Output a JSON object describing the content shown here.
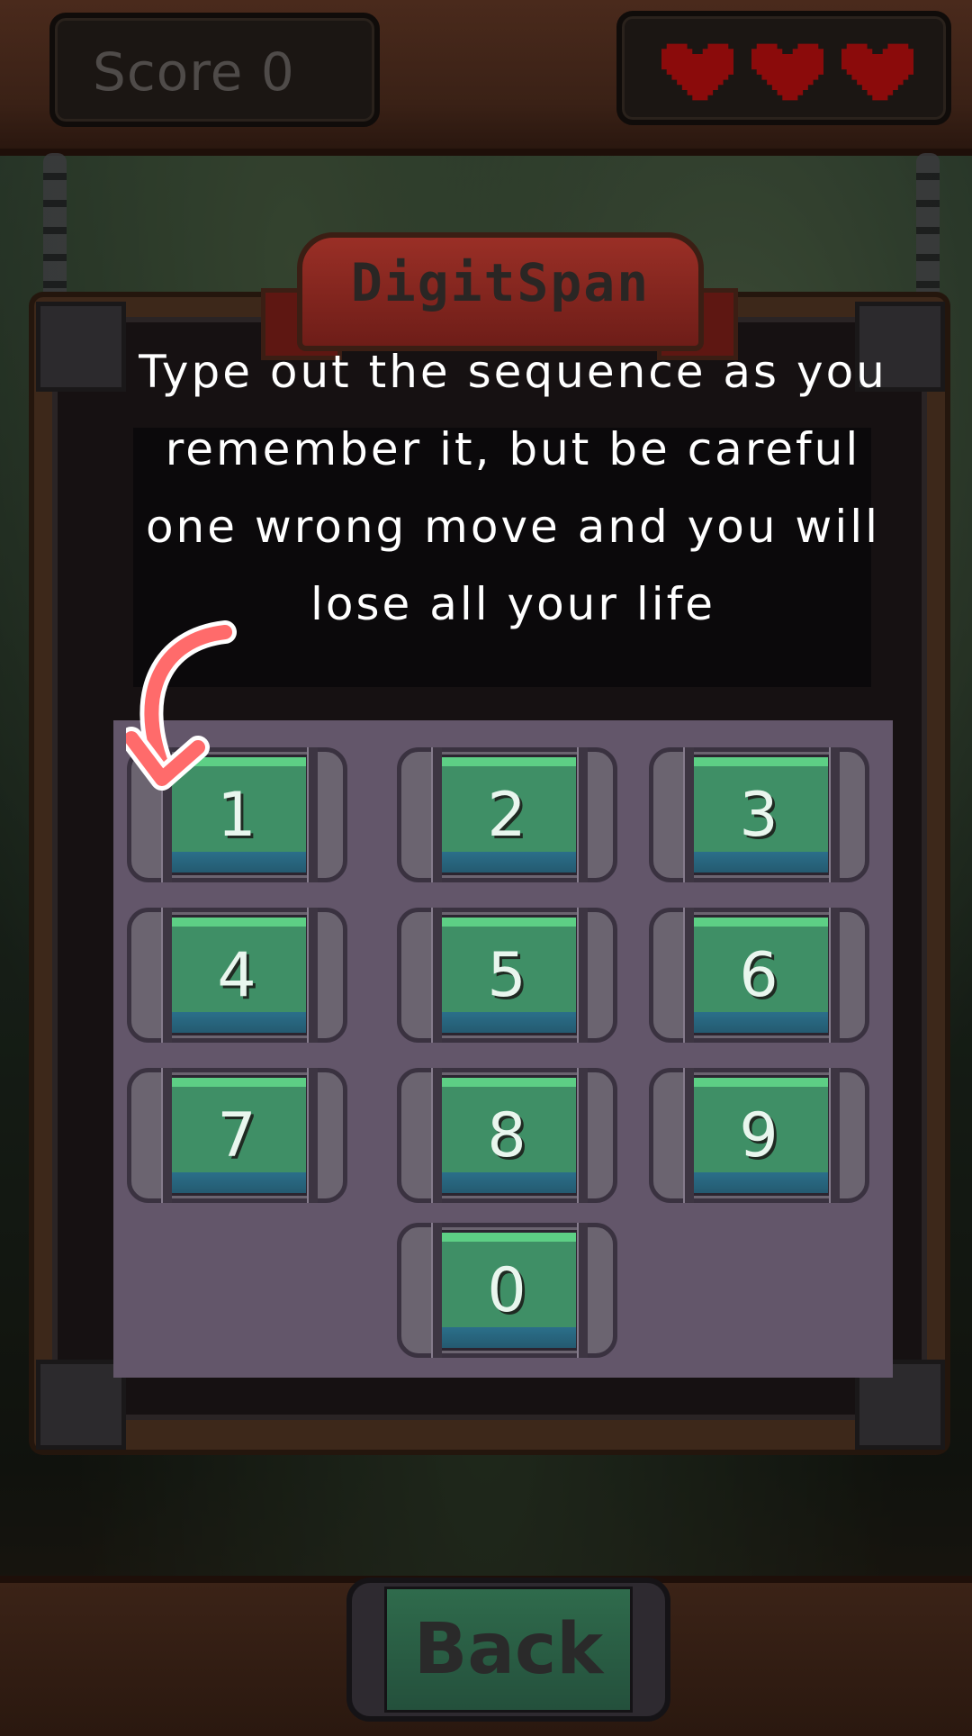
{
  "hud": {
    "score_text": "Score 0",
    "lives": 3,
    "heart_color": "#8b0b0b"
  },
  "panel": {
    "title": "DigitSpan",
    "instructions_lines": [
      "Type out the sequence as you",
      "remember it, but be careful",
      "one wrong move and you will",
      "lose all your life"
    ]
  },
  "keypad": {
    "keys": [
      "1",
      "2",
      "3",
      "4",
      "5",
      "6",
      "7",
      "8",
      "9",
      "0"
    ],
    "hint_arrow_color": "#ff6b6b",
    "hint_target": "1"
  },
  "footer": {
    "back_label": "Back"
  }
}
